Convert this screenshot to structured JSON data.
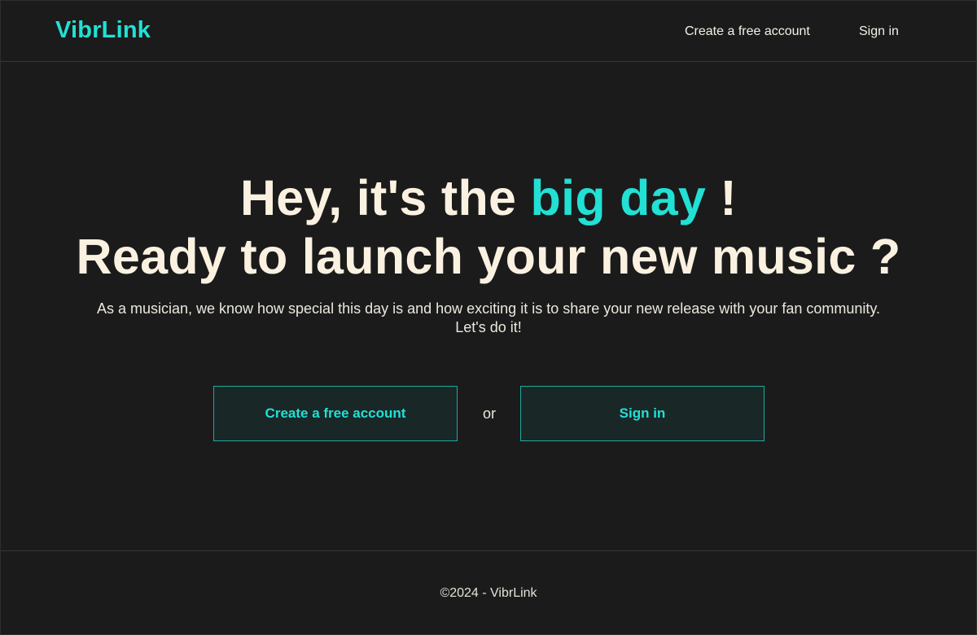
{
  "header": {
    "logo": "VibrLink",
    "nav": {
      "create_account": "Create a free account",
      "sign_in": "Sign in"
    }
  },
  "hero": {
    "line1_prefix": "Hey, it's the ",
    "line1_highlight": "big day",
    "line1_suffix": " !",
    "line2": "Ready to launch your new music ?",
    "subtitle_line1": "As a musician, we know how special this day is and how exciting it is to share your new release with your fan community.",
    "subtitle_line2": "Let's do it!"
  },
  "cta": {
    "create_account": "Create a free account",
    "separator": "or",
    "sign_in": "Sign in"
  },
  "footer": {
    "copyright": "©2024 - VibrLink"
  },
  "colors": {
    "background": "#1b1b1b",
    "accent": "#22e0d4",
    "text": "#fbf1e1",
    "button_bg": "#1a2727",
    "button_border": "#1fa99f"
  }
}
